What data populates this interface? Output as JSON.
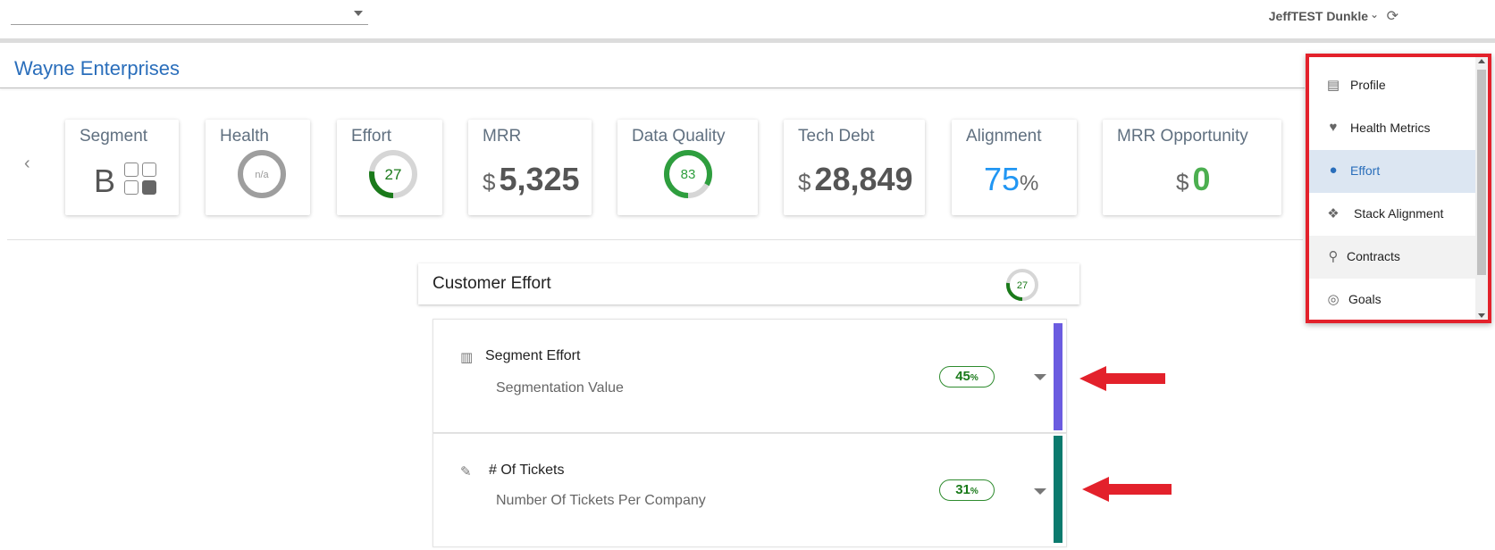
{
  "topbar": {
    "select_value": "",
    "user_name": "JeffTEST Dunkle",
    "chevron": "⌄",
    "refresh_glyph": "⟳"
  },
  "company": {
    "name": "Wayne Enterprises"
  },
  "nav": {
    "prev_glyph": "‹"
  },
  "cards": {
    "segment": {
      "label": "Segment",
      "value": "B"
    },
    "health": {
      "label": "Health",
      "value": "n/a"
    },
    "effort": {
      "label": "Effort",
      "value": "27",
      "fraction": 0.27
    },
    "mrr": {
      "label": "MRR",
      "currency": "$",
      "value": "5,325"
    },
    "data_quality": {
      "label": "Data Quality",
      "value": "83",
      "fraction": 0.83
    },
    "tech_debt": {
      "label": "Tech Debt",
      "currency": "$",
      "value": "28,849"
    },
    "alignment": {
      "label": "Alignment",
      "value": "75",
      "unit": "%"
    },
    "mrr_opportunity": {
      "label": "MRR Opportunity",
      "currency": "$",
      "value": "0"
    }
  },
  "customer_effort": {
    "title": "Customer Effort",
    "score": "27",
    "fraction": 0.27,
    "rows": [
      {
        "title": "Segment Effort",
        "subtitle": "Segmentation Value",
        "percent": "45",
        "unit": "%",
        "icon": "building-icon",
        "color": "#6b5ce0"
      },
      {
        "title": "# Of Tickets",
        "subtitle": "Number Of Tickets Per Company",
        "percent": "31",
        "unit": "%",
        "icon": "ticket-icon",
        "color": "#0b7a6e"
      }
    ]
  },
  "menu": {
    "items": [
      {
        "label": "Profile",
        "icon": "id-card-icon",
        "glyph": "▤"
      },
      {
        "label": "Health Metrics",
        "icon": "heartbeat-icon",
        "glyph": "♥"
      },
      {
        "label": "Effort",
        "icon": "rebel-icon",
        "glyph": "●"
      },
      {
        "label": "Stack Alignment",
        "icon": "cubes-icon",
        "glyph": "❖"
      },
      {
        "label": "Contracts",
        "icon": "paperclip-icon",
        "glyph": "⚲"
      },
      {
        "label": "Goals",
        "icon": "target-icon",
        "glyph": "◎"
      }
    ],
    "active_index": 2
  },
  "colors": {
    "accent": "#2a6ebb",
    "green": "#1a7a1a",
    "annotation_red": "#e3212b",
    "alignment_blue": "#2196f3",
    "opportunity_green": "#4caf50"
  }
}
